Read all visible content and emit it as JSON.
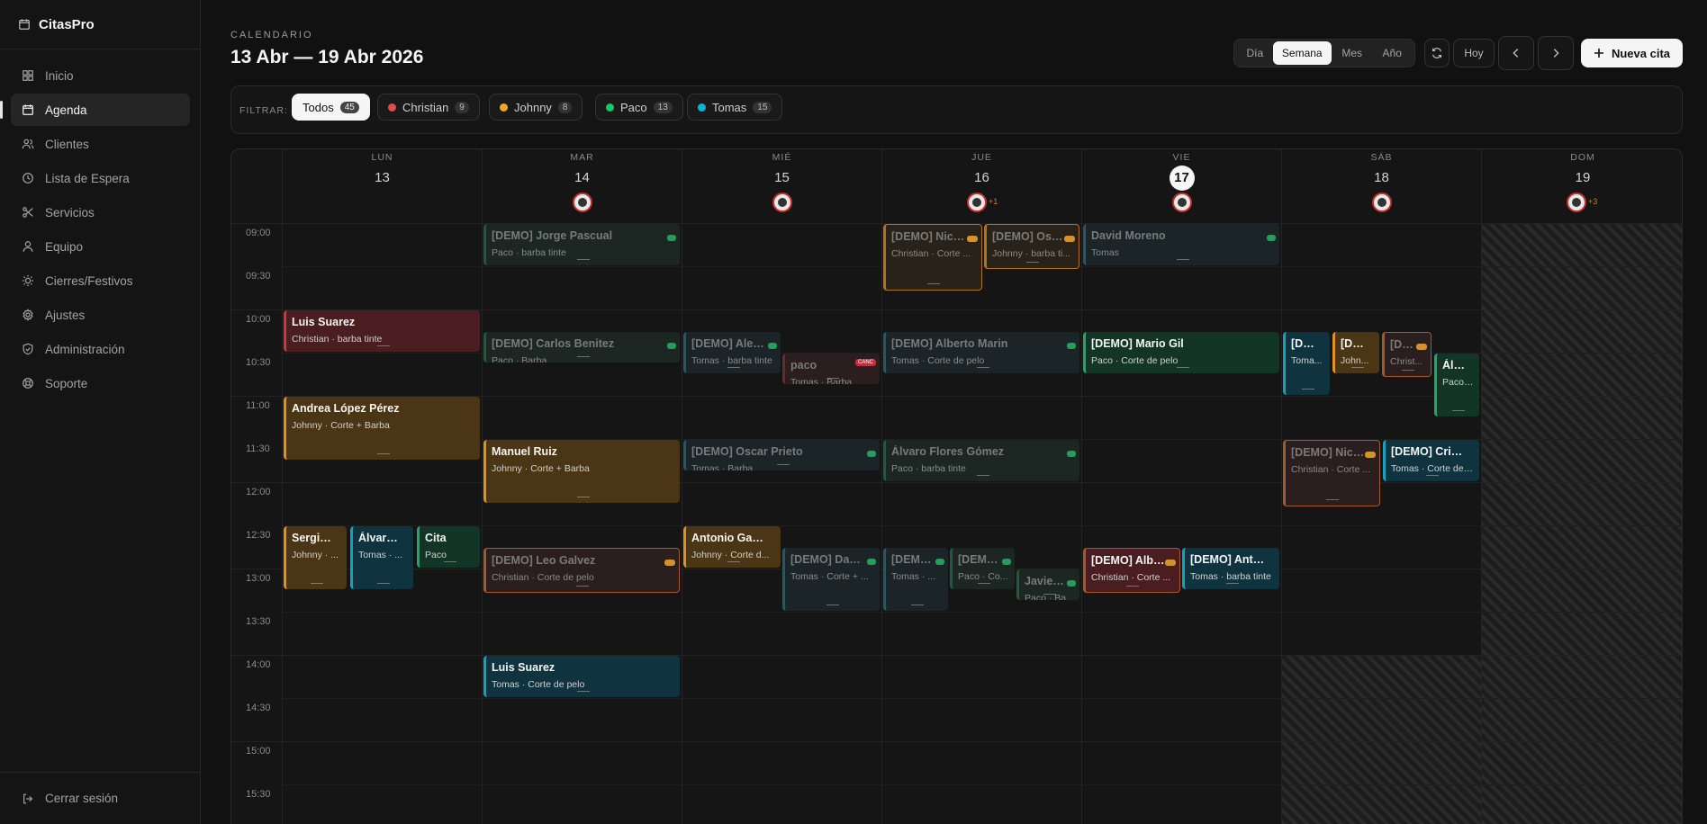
{
  "app": {
    "name": "CitasPro"
  },
  "sidebar": {
    "items": [
      {
        "label": "Inicio",
        "icon": "grid-icon"
      },
      {
        "label": "Agenda",
        "icon": "calendar-icon",
        "active": true
      },
      {
        "label": "Clientes",
        "icon": "users-icon"
      },
      {
        "label": "Lista de Espera",
        "icon": "clock-icon"
      },
      {
        "label": "Servicios",
        "icon": "scissors-icon"
      },
      {
        "label": "Equipo",
        "icon": "user-icon"
      },
      {
        "label": "Cierres/Festivos",
        "icon": "sun-icon"
      },
      {
        "label": "Ajustes",
        "icon": "gear-icon"
      },
      {
        "label": "Administración",
        "icon": "shield-icon"
      },
      {
        "label": "Soporte",
        "icon": "lifebuoy-icon"
      }
    ],
    "logout": "Cerrar sesión"
  },
  "header": {
    "kicker": "CALENDARIO",
    "range": "13 Abr — 19 Abr 2026",
    "views": [
      "Día",
      "Semana",
      "Mes",
      "Año"
    ],
    "active_view": "Semana",
    "today_label": "Hoy",
    "new_label": "Nueva cita"
  },
  "filters": {
    "label": "FILTRAR:",
    "chips": [
      {
        "label": "Todos",
        "count": "45",
        "color": "",
        "active": true
      },
      {
        "label": "Christian",
        "count": "9",
        "color": "#e5484d"
      },
      {
        "label": "Johnny",
        "count": "8",
        "color": "#f5a524"
      },
      {
        "label": "Paco",
        "count": "13",
        "color": "#17c964"
      },
      {
        "label": "Tomas",
        "count": "15",
        "color": "#06b6d4"
      }
    ]
  },
  "calendar": {
    "days": [
      {
        "name": "LUN",
        "date": "13"
      },
      {
        "name": "MAR",
        "date": "14"
      },
      {
        "name": "MIÉ",
        "date": "15"
      },
      {
        "name": "JUE",
        "date": "16",
        "extra": "+1"
      },
      {
        "name": "VIE",
        "date": "17",
        "today": true
      },
      {
        "name": "SÁB",
        "date": "18"
      },
      {
        "name": "DOM",
        "date": "19",
        "extra": "+3"
      }
    ],
    "times": [
      "09:00",
      "09:30",
      "10:00",
      "10:30",
      "11:00",
      "11:30",
      "12:00",
      "12:30",
      "13:00",
      "13:30",
      "14:00",
      "14:30",
      "15:00",
      "15:30"
    ],
    "events": [
      {
        "title": "Luis Suarez",
        "sub": "Christian · barba tinte",
        "color": "red"
      },
      {
        "title": "Andrea López Pérez",
        "sub": "Johnny · Corte + Barba",
        "color": "orange"
      },
      {
        "title": "Sergio ...",
        "sub": "Johnny · ...",
        "color": "orange"
      },
      {
        "title": "Álvaro ...",
        "sub": "Tomas · ...",
        "color": "blue"
      },
      {
        "title": "Cita",
        "sub": "Paco",
        "color": "green"
      },
      {
        "title": "[DEMO] Jorge Pascual",
        "sub": "Paco · barba tinte",
        "color": "green",
        "dim": true,
        "badge": "ok"
      },
      {
        "title": "[DEMO] Carlos Benitez",
        "sub": "Paco · Barba",
        "color": "green",
        "dim": true,
        "badge": "ok"
      },
      {
        "title": "Manuel Ruiz",
        "sub": "Johnny · Corte + Barba",
        "color": "orange"
      },
      {
        "title": "[DEMO] Leo Galvez",
        "sub": "Christian · Corte de pelo",
        "color": "red",
        "dim": true,
        "badge": "warn"
      },
      {
        "title": "Luis Suarez",
        "sub": "Tomas · Corte de pelo",
        "color": "blue"
      },
      {
        "title": "[DEMO] Aleja...",
        "sub": "Tomas · barba tinte",
        "color": "blue",
        "dim": true,
        "badge": "ok"
      },
      {
        "title": "paco",
        "sub": "Tomas · Barba",
        "color": "red",
        "dim": true,
        "badge": "canc"
      },
      {
        "title": "[DEMO] Oscar Prieto",
        "sub": "Tomas · Barba",
        "color": "blue",
        "dim": true,
        "badge": "ok"
      },
      {
        "title": "Antonio García",
        "sub": "Johnny · Corte d...",
        "color": "orange"
      },
      {
        "title": "[DEMO] Davi...",
        "sub": "Tomas · Corte + ...",
        "color": "blue",
        "dim": true,
        "badge": "ok"
      },
      {
        "title": "[DEMO] Nicol...",
        "sub": "Christian · Corte ...",
        "color": "orange",
        "dim": true,
        "badge": "warn"
      },
      {
        "title": "[DEMO] Osca...",
        "sub": "Johnny · barba ti...",
        "color": "orange",
        "dim": true,
        "badge": "warn"
      },
      {
        "title": "[DEMO] Alberto Marin",
        "sub": "Tomas · Corte de pelo",
        "color": "blue",
        "dim": true,
        "badge": "ok"
      },
      {
        "title": "Álvaro Flores Gómez",
        "sub": "Paco · barba tinte",
        "color": "green",
        "dim": true,
        "badge": "ok"
      },
      {
        "title": "[DEMO...",
        "sub": "Tomas · ...",
        "color": "blue",
        "dim": true,
        "badge": "ok"
      },
      {
        "title": "[DEMO...",
        "sub": "Paco · Co...",
        "color": "green",
        "dim": true,
        "badge": "ok"
      },
      {
        "title": "Javier ...",
        "sub": "Paco · Ba...",
        "color": "green",
        "dim": true,
        "badge": "ok"
      },
      {
        "title": "David Moreno",
        "sub": "Tomas",
        "color": "blue",
        "dim": true,
        "badge": "ok"
      },
      {
        "title": "[DEMO] Mario Gil",
        "sub": "Paco · Corte de pelo",
        "color": "green"
      },
      {
        "title": "[DEMO] Alber...",
        "sub": "Christian · Corte ...",
        "color": "red",
        "badge": "warn"
      },
      {
        "title": "[DEMO] Anto...",
        "sub": "Tomas · barba tinte",
        "color": "blue"
      },
      {
        "title": "[DE...",
        "sub": "Toma...",
        "color": "blue"
      },
      {
        "title": "[DE...",
        "sub": "John...",
        "color": "orange"
      },
      {
        "title": "[DE...",
        "sub": "Christ...",
        "color": "red",
        "dim": true,
        "badge": "warn"
      },
      {
        "title": "Álv...",
        "sub": "Paco ...",
        "color": "green"
      },
      {
        "title": "[DEMO] Nicol...",
        "sub": "Christian · Corte ...",
        "color": "red",
        "dim": true,
        "badge": "warn"
      },
      {
        "title": "[DEMO] Cristi...",
        "sub": "Tomas · Corte de ...",
        "color": "blue"
      }
    ],
    "cancel_badge": "CANC"
  }
}
